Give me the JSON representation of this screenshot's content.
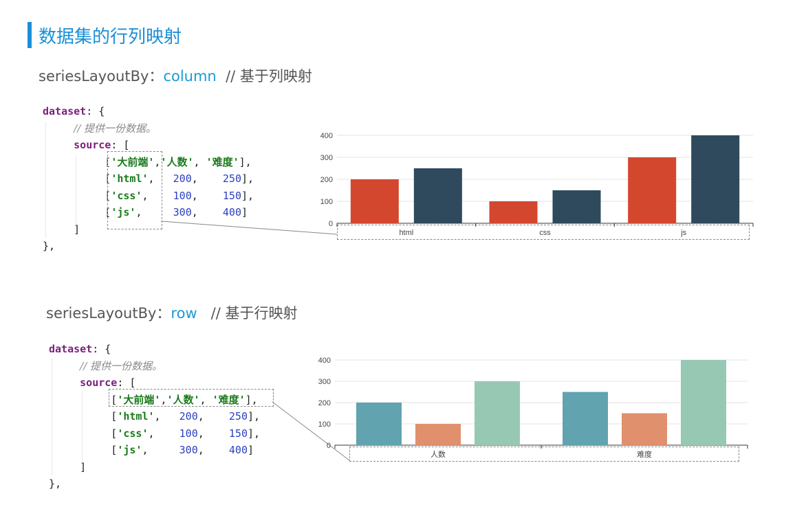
{
  "title": "数据集的行列映射",
  "section1": {
    "label": "seriesLayoutBy：",
    "keyword": "column",
    "comment": "// 基于列映射"
  },
  "section2": {
    "label": "seriesLayoutBy：",
    "keyword": "row",
    "comment": "// 基于行映射"
  },
  "code": {
    "dataset": "dataset",
    "comment": "// 提供一份数据。",
    "source": "source",
    "rows": [
      [
        "'大前端'",
        "'人数'",
        "'难度'"
      ],
      [
        "'html'",
        "200",
        "250"
      ],
      [
        "'css'",
        "100",
        "150"
      ],
      [
        "'js'",
        "300",
        "400"
      ]
    ]
  },
  "colors": {
    "title": "#1a8fd6",
    "red": "#d4472f",
    "navy": "#2f4a5c",
    "teal": "#62a3b0",
    "orange": "#e0906c",
    "mint": "#97c8b3"
  },
  "chart_data": [
    {
      "type": "bar",
      "categories": [
        "html",
        "css",
        "js"
      ],
      "series": [
        {
          "values": [
            200,
            100,
            300
          ]
        },
        {
          "values": [
            250,
            150,
            400
          ]
        }
      ],
      "ylim": [
        0,
        400
      ],
      "yticks": [
        0,
        100,
        200,
        300,
        400
      ],
      "grid": true
    },
    {
      "type": "bar",
      "categories": [
        "人数",
        "难度"
      ],
      "series": [
        {
          "values": [
            200,
            250
          ]
        },
        {
          "values": [
            100,
            150
          ]
        },
        {
          "values": [
            300,
            400
          ]
        }
      ],
      "ylim": [
        0,
        400
      ],
      "yticks": [
        0,
        100,
        200,
        300,
        400
      ],
      "grid": true
    }
  ]
}
